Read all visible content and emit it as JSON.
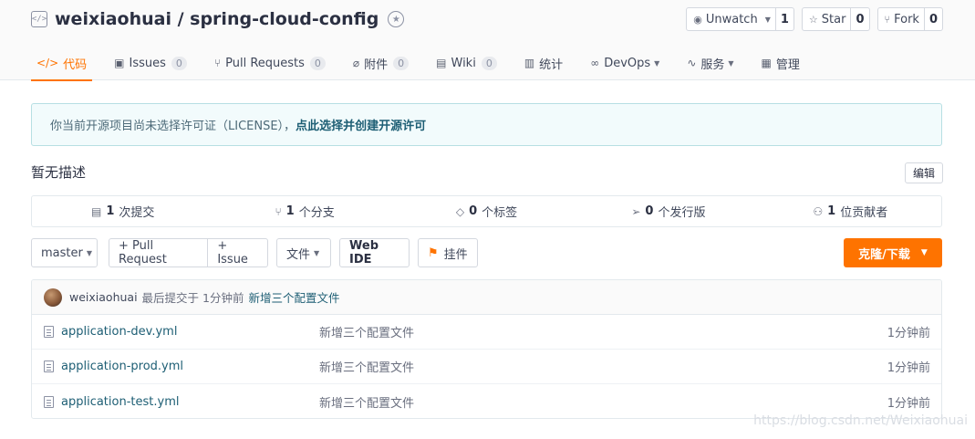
{
  "repo": {
    "full_name": "weixiaohuai / spring-cloud-config"
  },
  "actions": [
    {
      "label": "Unwatch",
      "count": "1"
    },
    {
      "label": "Star",
      "count": "0"
    },
    {
      "label": "Fork",
      "count": "0"
    }
  ],
  "tabs": [
    {
      "label": "代码",
      "count": ""
    },
    {
      "label": "Issues",
      "count": "0"
    },
    {
      "label": "Pull Requests",
      "count": "0"
    },
    {
      "label": "附件",
      "count": "0"
    },
    {
      "label": "Wiki",
      "count": "0"
    },
    {
      "label": "统计",
      "count": ""
    },
    {
      "label": "DevOps",
      "count": ""
    },
    {
      "label": "服务",
      "count": ""
    },
    {
      "label": "管理",
      "count": ""
    }
  ],
  "notice": {
    "text": "你当前开源项目尚未选择许可证（LICENSE），",
    "link": "点此选择并创建开源许可"
  },
  "description": {
    "text": "暂无描述",
    "edit_label": "编辑"
  },
  "stats": [
    {
      "count": "1",
      "label": "次提交"
    },
    {
      "count": "1",
      "label": "个分支"
    },
    {
      "count": "0",
      "label": "个标签"
    },
    {
      "count": "0",
      "label": "个发行版"
    },
    {
      "count": "1",
      "label": "位贡献者"
    }
  ],
  "toolbar": {
    "branch": "master",
    "pull_request": "+ Pull Request",
    "issue": "+ Issue",
    "files": "文件",
    "web_ide": "Web IDE",
    "widget": "挂件",
    "clone": "克隆/下载"
  },
  "last_commit": {
    "user": "weixiaohuai",
    "meta": "最后提交于 1分钟前",
    "message": "新增三个配置文件"
  },
  "files": [
    {
      "name": "application-dev.yml",
      "message": "新增三个配置文件",
      "time": "1分钟前"
    },
    {
      "name": "application-prod.yml",
      "message": "新增三个配置文件",
      "time": "1分钟前"
    },
    {
      "name": "application-test.yml",
      "message": "新增三个配置文件",
      "time": "1分钟前"
    }
  ],
  "watermark": "https://blog.csdn.net/Weixiaohuai",
  "colors": {
    "accent": "#fe7300",
    "link": "#1d5e74",
    "notice_bg": "#f2fbfc"
  }
}
